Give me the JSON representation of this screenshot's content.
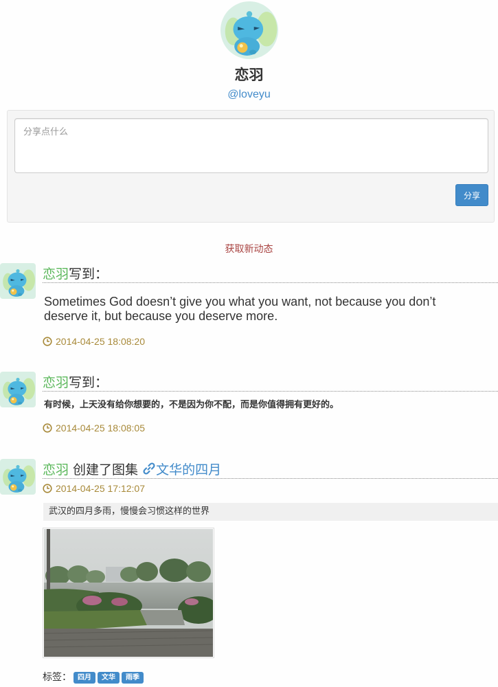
{
  "profile": {
    "name": "恋羽",
    "handle": "@loveyu"
  },
  "composer": {
    "placeholder": "分享点什么",
    "share_label": "分享"
  },
  "fetch_label": "获取新动态",
  "feed": [
    {
      "author": "恋羽",
      "verb": "写到：",
      "text": "Sometimes God doesn’t give you what you want, not because you don’t deserve it, but because you deserve more.",
      "time": "2014-04-25 18:08:20"
    },
    {
      "author": "恋羽",
      "verb": "写到：",
      "text": "有时候，上天没有给你想要的，不是因为你不配，而是你值得拥有更好的。",
      "time": "2014-04-25 18:08:05"
    },
    {
      "author": "恋羽",
      "verb": " 创建了图集 ",
      "album": "文华的四月",
      "time": "2014-04-25 17:12:07",
      "caption": "武汉的四月多雨，慢慢会习惯这样的世界",
      "tags_label": "标签：",
      "tags": [
        "四月",
        "文华",
        "雨季"
      ]
    }
  ],
  "colors": {
    "primary": "#428bca",
    "author": "#5cb85c",
    "timestamp": "#a88a3a",
    "fetch_link": "#a94442"
  },
  "icons": {
    "time": "clock-icon",
    "album_link": "link-icon"
  }
}
